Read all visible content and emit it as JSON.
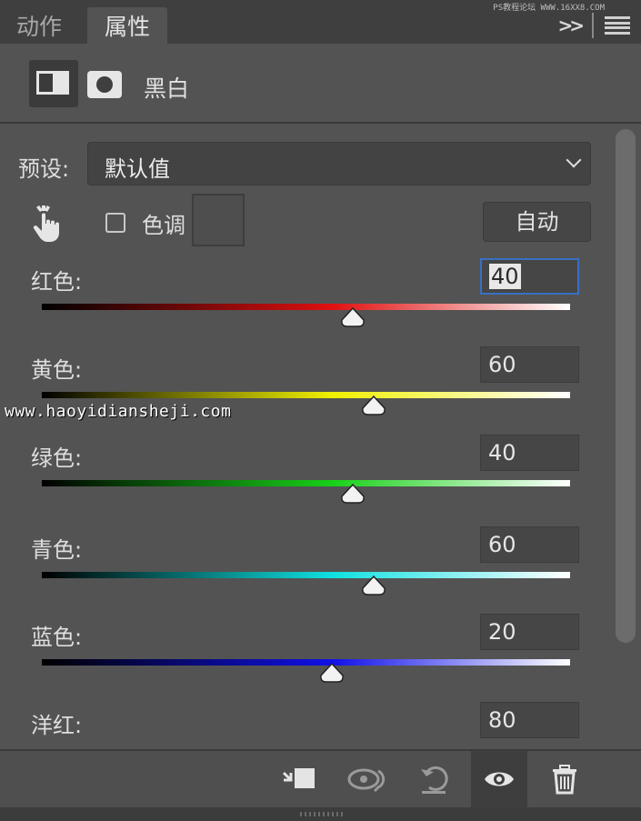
{
  "tabs": [
    {
      "label": "动作",
      "active": false
    },
    {
      "label": "属性",
      "active": true
    }
  ],
  "top_watermark": "PS教程论坛 WWW.16XX8.COM",
  "panel": {
    "title": "黑白"
  },
  "preset": {
    "label": "预设:",
    "value": "默认值"
  },
  "tint": {
    "label": "色调",
    "checked": false
  },
  "auto_button": "自动",
  "sliders": [
    {
      "label": "红色:",
      "value": "40",
      "color": "#e01010",
      "focused": true
    },
    {
      "label": "黄色:",
      "value": "60",
      "color": "#f0f000",
      "focused": false
    },
    {
      "label": "绿色:",
      "value": "40",
      "color": "#18d018",
      "focused": false
    },
    {
      "label": "青色:",
      "value": "60",
      "color": "#10e0e0",
      "focused": false
    },
    {
      "label": "蓝色:",
      "value": "20",
      "color": "#1010e8",
      "focused": false
    },
    {
      "label": "洋红:",
      "value": "80",
      "color": "#e010e0",
      "focused": false
    }
  ],
  "watermark": "www.haoyidiansheji.com",
  "toolbar_icons": [
    "clip-to-layer-icon",
    "view-previous-state-icon",
    "reset-icon",
    "visibility-eye-icon",
    "trash-icon"
  ]
}
